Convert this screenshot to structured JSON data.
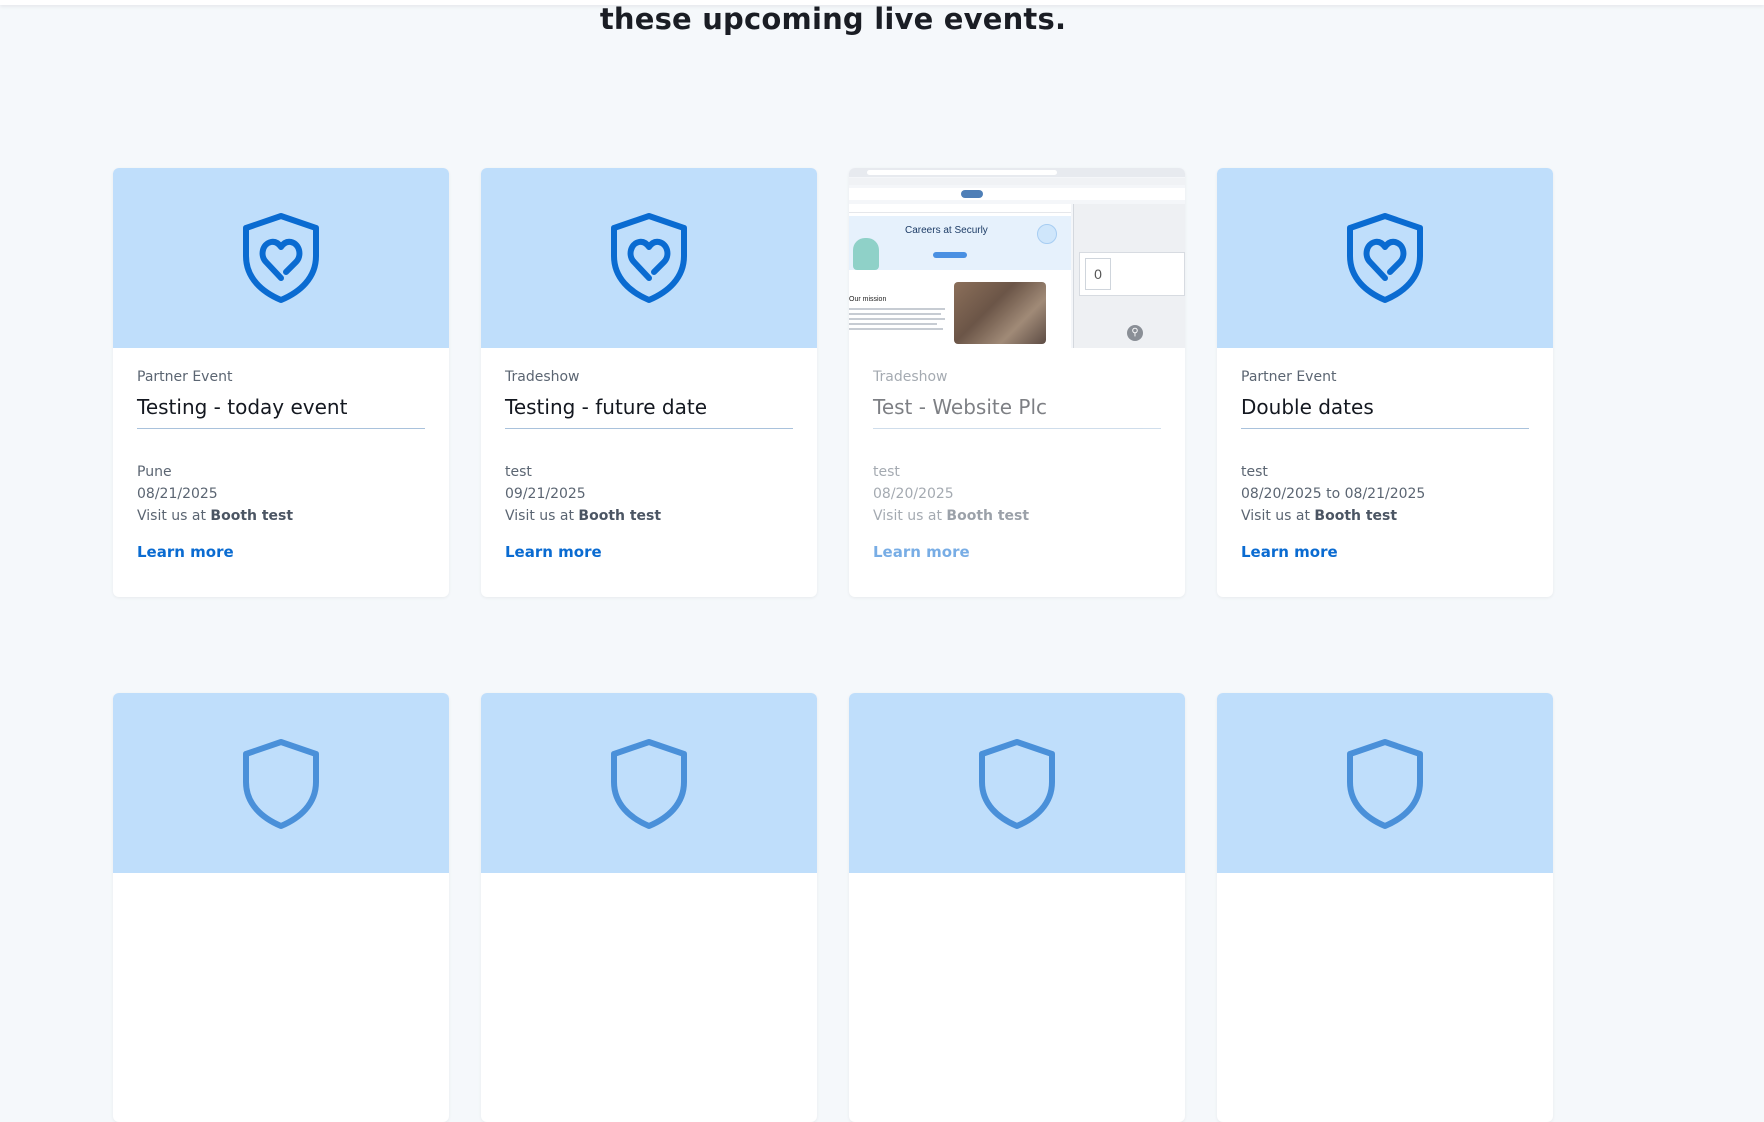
{
  "heading": "these upcoming live events.",
  "colors": {
    "background": "#f5f8fb",
    "media_background": "#bfdefb",
    "icon_blue": "#0a6bd1",
    "link_blue": "#0a6bd1"
  },
  "events": [
    {
      "type": "Partner Event",
      "title": "Testing - today event",
      "location": "Pune",
      "date": "08/21/2025",
      "booth_prefix": "Visit us at",
      "booth_name": "Booth test",
      "link": "Learn more",
      "icon": "shield-heart-icon"
    },
    {
      "type": "Tradeshow",
      "title": "Testing - future date",
      "location": "test",
      "date": "09/21/2025",
      "booth_prefix": "Visit us at",
      "booth_name": "Booth test",
      "link": "Learn more",
      "icon": "shield-heart-icon"
    },
    {
      "type": "Tradeshow",
      "title": "Test - Website Plc",
      "location": "test",
      "date": "08/20/2025",
      "booth_prefix": "Visit us at",
      "booth_name": "Booth test",
      "link": "Learn more",
      "image_caption": "Careers at Securly",
      "image_subcaption": "Our mission",
      "image_counter": "0"
    },
    {
      "type": "Partner Event",
      "title": "Double dates",
      "location": "test",
      "date": "08/20/2025 to 08/21/2025",
      "booth_prefix": "Visit us at",
      "booth_name": "Booth test",
      "link": "Learn more",
      "icon": "shield-heart-icon"
    }
  ]
}
